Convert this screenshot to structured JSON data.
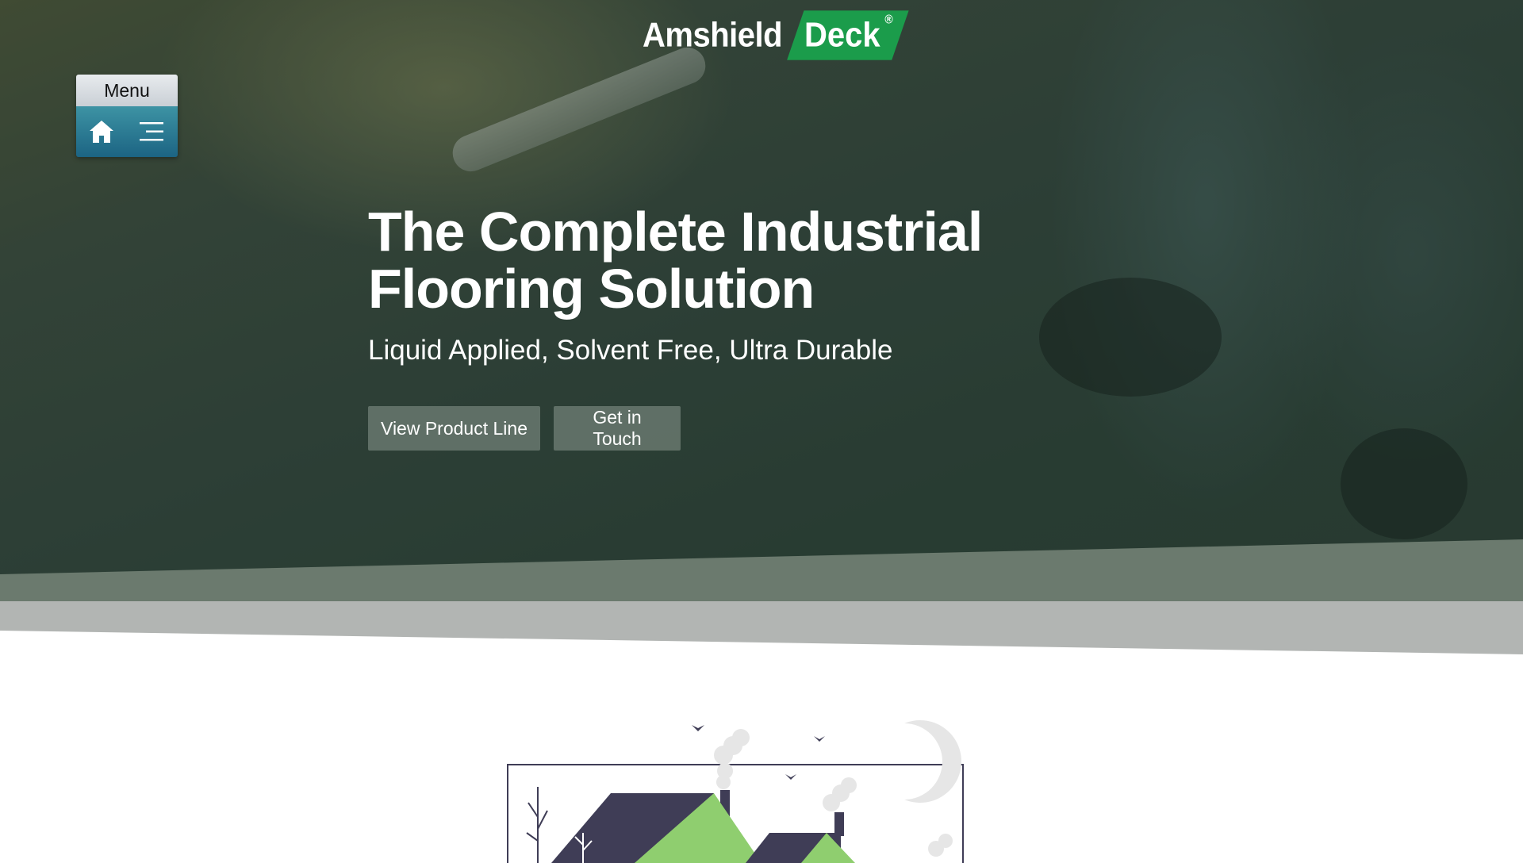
{
  "brand": {
    "name_part1": "Amshield",
    "name_part2": "Deck",
    "registered": "®",
    "accent_color": "#1b9c4b"
  },
  "menu": {
    "label": "Menu",
    "home_icon": "home-icon",
    "hamburger_icon": "hamburger-icon"
  },
  "hero": {
    "headline": "The Complete Industrial Flooring Solution",
    "subheadline": "Liquid Applied, Solvent Free, Ultra Durable",
    "buttons": {
      "product_line": "View Product Line",
      "get_in_touch": "Get in Touch"
    }
  },
  "illustration": {
    "name": "factory-illustration",
    "primary_color": "#3f3d56",
    "accent_color": "#8fce6f"
  }
}
